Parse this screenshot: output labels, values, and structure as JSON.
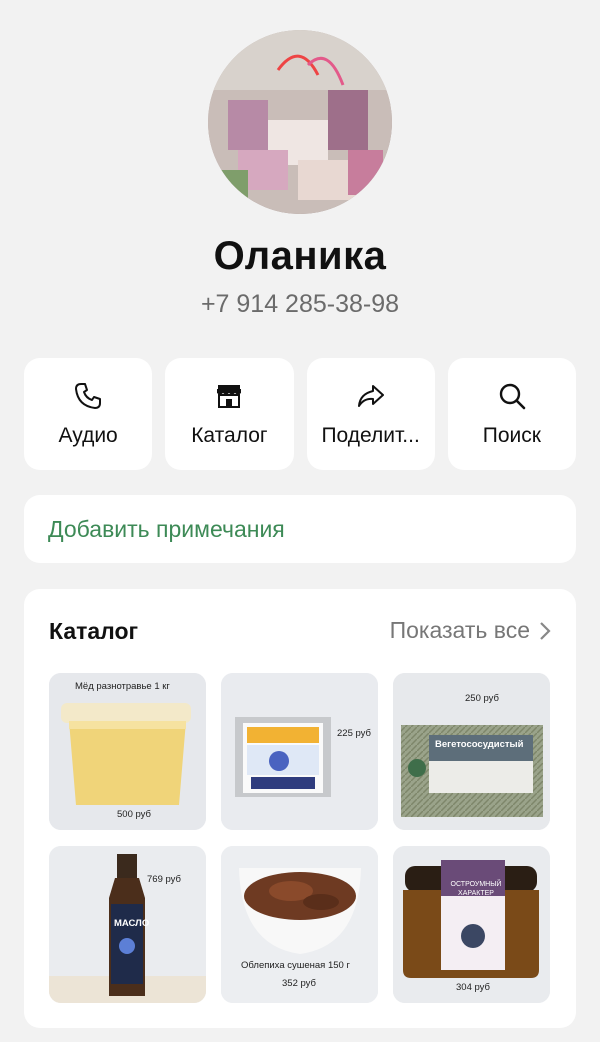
{
  "profile": {
    "name": "Оланика",
    "phone": "+7 914 285-38-98"
  },
  "actions": [
    {
      "label": "Аудио",
      "icon": "phone-icon"
    },
    {
      "label": "Каталог",
      "icon": "storefront-icon"
    },
    {
      "label": "Поделит...",
      "icon": "share-icon"
    },
    {
      "label": "Поиск",
      "icon": "search-icon"
    }
  ],
  "notes": {
    "label": "Добавить примечания"
  },
  "catalog": {
    "title": "Каталог",
    "show_all": "Показать все",
    "items": [
      {
        "caption": "Мёд разнотравье 1 кг",
        "price": "500 руб"
      },
      {
        "caption": "",
        "price": "225 руб"
      },
      {
        "caption": "",
        "price": "250 руб",
        "package_text": "Вегетососудистый"
      },
      {
        "caption": "",
        "price": "769 руб",
        "bottle_text": "МАСЛО"
      },
      {
        "caption": "Облепиха сушеная 150 г",
        "price": "352 руб"
      },
      {
        "caption": "",
        "price": "304 руб",
        "label_text": "ОСТРОУМНЫЙ ХАРАКТЕР"
      }
    ]
  },
  "colors": {
    "background": "#f2f2f2",
    "accent_green": "#3d8a56",
    "secondary_text": "#6b6b6b"
  }
}
